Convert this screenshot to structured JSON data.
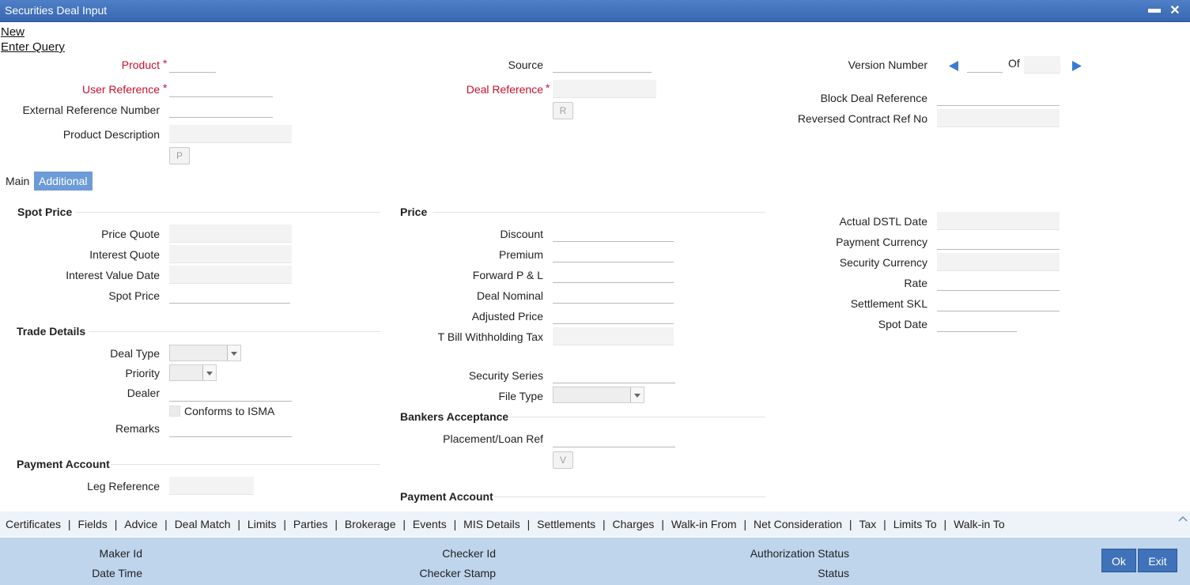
{
  "window": {
    "title": "Securities Deal Input",
    "minimize": "▬",
    "close": "✕"
  },
  "menu": {
    "new": "New",
    "enter_query": "Enter Query"
  },
  "header": {
    "product": "Product",
    "user_reference": "User Reference",
    "external_reference_number": "External Reference Number",
    "product_description": "Product Description",
    "p_button": "P",
    "source": "Source",
    "deal_reference": "Deal Reference",
    "r_button": "R",
    "version_number": "Version Number",
    "of": "Of",
    "block_deal_reference": "Block Deal Reference",
    "reversed_contract_ref_no": "Reversed Contract Ref No",
    "required_mark": "*"
  },
  "tabs": {
    "main": "Main",
    "additional": "Additional"
  },
  "spot_price": {
    "title": "Spot Price",
    "price_quote": "Price Quote",
    "interest_quote": "Interest Quote",
    "interest_value_date": "Interest Value Date",
    "spot_price": "Spot Price"
  },
  "trade_details": {
    "title": "Trade Details",
    "deal_type": "Deal Type",
    "priority": "Priority",
    "dealer": "Dealer",
    "conforms_to_isma": "Conforms to ISMA",
    "remarks": "Remarks"
  },
  "payment_account_left": {
    "title": "Payment Account",
    "leg_reference": "Leg Reference"
  },
  "price": {
    "title": "Price",
    "discount": "Discount",
    "premium": "Premium",
    "forward_pl": "Forward P & L",
    "deal_nominal": "Deal Nominal",
    "adjusted_price": "Adjusted Price",
    "t_bill_withholding_tax": "T Bill Withholding Tax",
    "security_series": "Security Series",
    "file_type": "File Type"
  },
  "bankers_acceptance": {
    "title": "Bankers Acceptance",
    "placement_loan_ref": "Placement/Loan Ref",
    "v_button": "V"
  },
  "payment_account_mid": {
    "title": "Payment Account"
  },
  "right_fields": {
    "actual_dstl_date": "Actual DSTL Date",
    "payment_currency": "Payment Currency",
    "security_currency": "Security Currency",
    "rate": "Rate",
    "settlement_skl": "Settlement SKL",
    "spot_date": "Spot Date"
  },
  "bottom_links": [
    "Certificates",
    "Fields",
    "Advice",
    "Deal Match",
    "Limits",
    "Parties",
    "Brokerage",
    "Events",
    "MIS Details",
    "Settlements",
    "Charges",
    "Walk-in From",
    "Net Consideration",
    "Tax",
    "Limits To",
    "Walk-in To"
  ],
  "footer": {
    "maker_id": "Maker Id",
    "date_time": "Date Time",
    "checker_id": "Checker Id",
    "checker_stamp": "Checker Stamp",
    "authorization_status": "Authorization Status",
    "status": "Status",
    "ok": "Ok",
    "exit": "Exit"
  },
  "colors": {
    "titlebar": "#3767b0",
    "required": "#c8102e",
    "footer": "#bed5ec",
    "tab_active": "#6d9bd7",
    "button": "#3f72b9"
  }
}
